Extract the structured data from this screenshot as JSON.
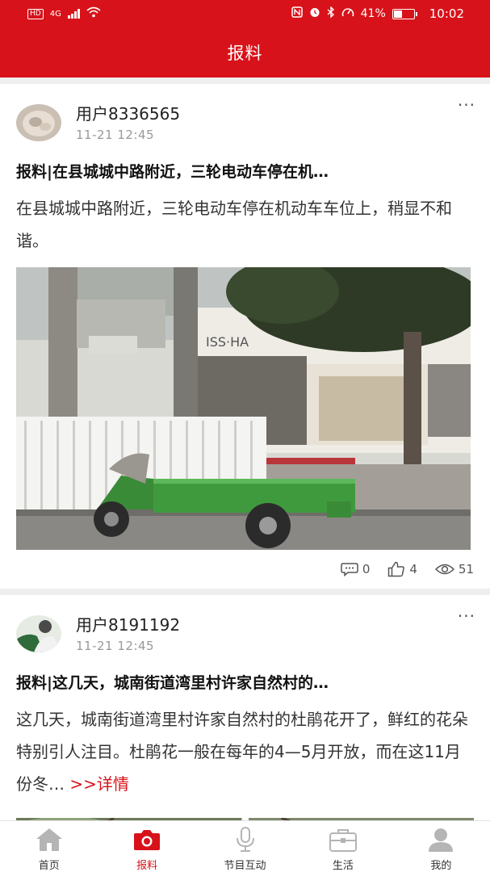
{
  "status_bar": {
    "network_badge": "HD",
    "network_type": "4G",
    "battery_percent": "41%",
    "battery_level": 0.41,
    "time": "10:02"
  },
  "header": {
    "title": "报料"
  },
  "posts": [
    {
      "username": "用户8336565",
      "time": "11-21 12:45",
      "title": "报料|在县城城中路附近，三轮电动车停在机…",
      "body": "在县城城中路附近，三轮电动车停在机动车车位上，稍显不和谐。",
      "image_icon": "street-photo-tricycle",
      "stats": {
        "comments": "0",
        "likes": "4",
        "views": "51"
      }
    },
    {
      "username": "用户8191192",
      "time": "11-21 12:45",
      "title": "报料|这几天，城南街道湾里村许家自然村的…",
      "body": "这几天，城南街道湾里村许家自然村的杜鹃花开了，鲜红的花朵特别引人注目。杜鹃花一般在每年的4—5月开放，而在这11月份冬…",
      "more_link": ">>详情",
      "image_icon": "azalea-photo"
    }
  ],
  "bottom_nav": [
    {
      "label": "首页",
      "icon": "home-icon"
    },
    {
      "label": "报料",
      "icon": "camera-icon"
    },
    {
      "label": "节目互动",
      "icon": "microphone-icon"
    },
    {
      "label": "生活",
      "icon": "briefcase-icon"
    },
    {
      "label": "我的",
      "icon": "profile-icon"
    }
  ],
  "colors": {
    "brand_red": "#d8121a",
    "nav_inactive": "#b5b5b5",
    "meta_gray": "#999999"
  }
}
